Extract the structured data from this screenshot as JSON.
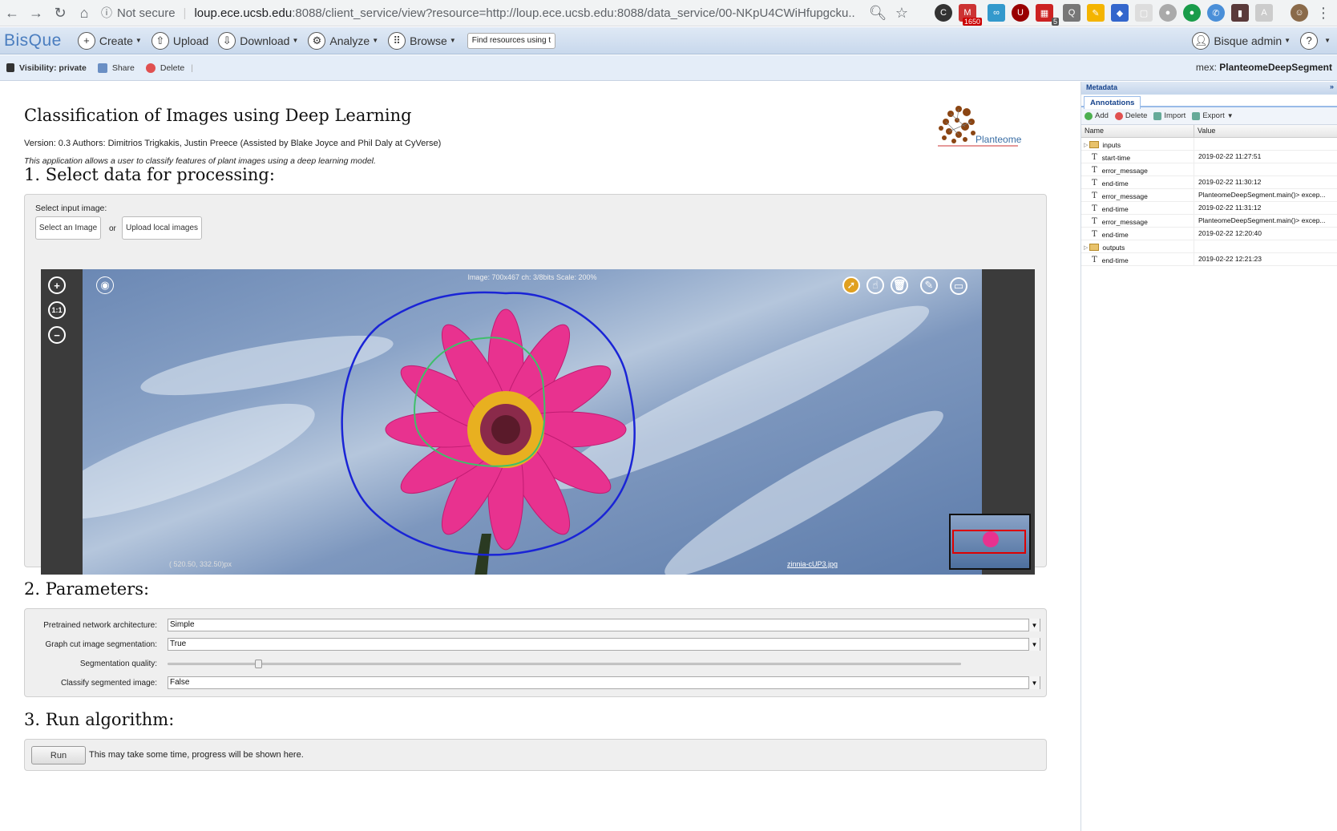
{
  "browser": {
    "security": "Not secure",
    "url_host": "loup.ece.ucsb.edu",
    "url_rest": ":8088/client_service/view?resource=http://loup.ece.ucsb.edu:8088/data_service/00-NKpU4CWiHfupgcku...",
    "ext_badge_1": "1650",
    "ext_badge_2": "5"
  },
  "app": {
    "logo": "BisQue",
    "menu": [
      "Create",
      "Upload",
      "Download",
      "Analyze",
      "Browse"
    ],
    "search_value": "Find resources using tag",
    "user": "Bisque admin",
    "help": "?"
  },
  "toolbar": {
    "visibility_label": "Visibility: private",
    "share": "Share",
    "delete": "Delete",
    "mex_prefix": "mex:",
    "mex_name": "PlanteomeDeepSegment"
  },
  "main": {
    "title": "Classification of Images using Deep Learning",
    "version": "Version: 0.3 Authors: Dimitrios Trigkakis, Justin Preece (Assisted by Blake Joyce and Phil Daly at CyVerse)",
    "description": "This application allows a user to classify features of plant images using a deep learning model.",
    "planteome_label": "Planteome",
    "step1": "1. Select data for processing:",
    "select_input_label": "Select input image:",
    "select_image_btn": "Select an Image",
    "or": "or",
    "upload_local_btn": "Upload local images",
    "step2": "2. Parameters:",
    "step3": "3. Run algorithm:",
    "run_btn": "Run",
    "run_msg": "This may take some time, progress will be shown here."
  },
  "viewer": {
    "info": "Image: 700x467 ch: 3/8bits Scale: 200%",
    "coords": "(    520.50,    332.50)px",
    "filename": "zinnia-cUP3.jpg",
    "zoom_reset": "1:1"
  },
  "params": [
    {
      "label": "Pretrained network architecture:",
      "value": "Simple"
    },
    {
      "label": "Graph cut image segmentation:",
      "value": "True"
    },
    {
      "label": "Segmentation quality:",
      "value": 0.11
    },
    {
      "label": "Classify segmented image:",
      "value": "False"
    }
  ],
  "metadata": {
    "panel_title": "Metadata",
    "tab": "Annotations",
    "tools": [
      "Add",
      "Delete",
      "Import",
      "Export"
    ],
    "col_name": "Name",
    "col_value": "Value",
    "rows": [
      {
        "name": "inputs",
        "value": "",
        "type": "folder"
      },
      {
        "name": "start-time",
        "value": "2019-02-22 11:27:51",
        "type": "tag"
      },
      {
        "name": "error_message",
        "value": "",
        "type": "tag"
      },
      {
        "name": "end-time",
        "value": "2019-02-22 11:30:12",
        "type": "tag"
      },
      {
        "name": "error_message",
        "value": "PlanteomeDeepSegment.main()> excep...",
        "type": "tag"
      },
      {
        "name": "end-time",
        "value": "2019-02-22 11:31:12",
        "type": "tag"
      },
      {
        "name": "error_message",
        "value": "PlanteomeDeepSegment.main()> excep...",
        "type": "tag"
      },
      {
        "name": "end-time",
        "value": "2019-02-22 12:20:40",
        "type": "tag"
      },
      {
        "name": "outputs",
        "value": "",
        "type": "folder"
      },
      {
        "name": "end-time",
        "value": "2019-02-22 12:21:23",
        "type": "tag"
      }
    ]
  },
  "colors": {
    "accent": "#4a7dbf",
    "flower": "#e8328f",
    "outline_outer": "#1a24d6",
    "outline_inner": "#3fbf6a"
  }
}
